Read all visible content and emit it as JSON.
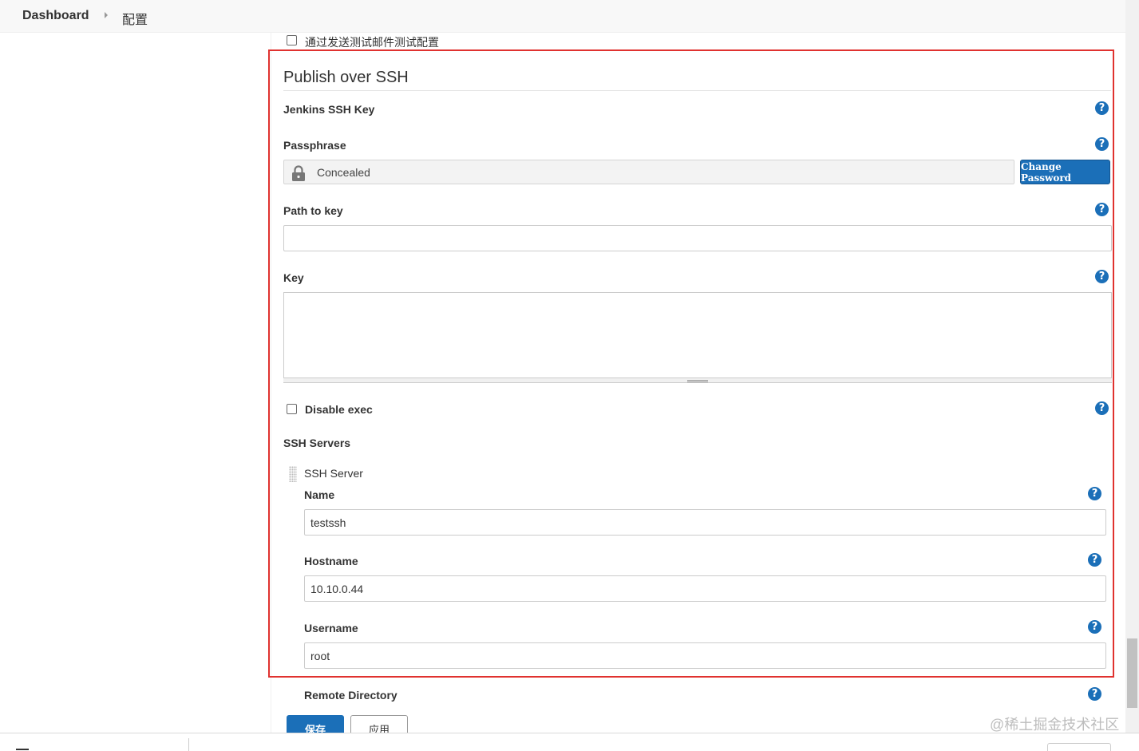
{
  "breadcrumb": {
    "home": "Dashboard",
    "current": "配置"
  },
  "test_email_checkbox": {
    "label": "通过发送测试邮件测试配置",
    "checked": false
  },
  "publish_over_ssh": {
    "title": "Publish over SSH",
    "jenkins_ssh_key_label": "Jenkins SSH Key",
    "passphrase_label": "Passphrase",
    "passphrase_value": "Concealed",
    "change_password_button": "Change Password",
    "path_to_key_label": "Path to key",
    "path_to_key_value": "",
    "key_label": "Key",
    "key_value": "",
    "disable_exec_label": "Disable exec",
    "disable_exec_checked": false,
    "ssh_servers_label": "SSH Servers",
    "ssh_server": {
      "header": "SSH Server",
      "name_label": "Name",
      "name_value": "testssh",
      "hostname_label": "Hostname",
      "hostname_value": "10.10.0.44",
      "username_label": "Username",
      "username_value": "root",
      "remote_directory_label": "Remote Directory"
    }
  },
  "actions": {
    "save": "保存",
    "apply": "应用"
  },
  "watermark": "@稀土掘金技术社区",
  "colors": {
    "accent": "#1b6fb8",
    "highlight_frame": "#e0322f"
  },
  "icons": {
    "help": "help-icon",
    "lock": "lock-icon",
    "breadcrumb_separator": "chevron-right-icon",
    "drag": "drag-handle-icon"
  }
}
